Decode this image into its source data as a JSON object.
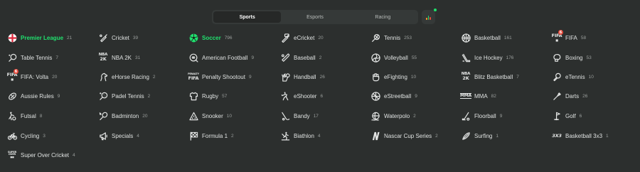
{
  "nav": {
    "tabs": [
      {
        "label": "Sports",
        "active": true
      },
      {
        "label": "Esports",
        "active": false
      },
      {
        "label": "Racing",
        "active": false
      }
    ],
    "stats_icon": "bar-chart-icon",
    "live_indicator_color": "#1fdf6b"
  },
  "colors": {
    "selected": "#20e06e",
    "background": "#2c2f2e",
    "badge": "#e94b3c"
  },
  "sports": [
    {
      "id": "premier-league",
      "label": "Premier League",
      "count": "21",
      "icon": "england-flag-icon",
      "selected": true
    },
    {
      "id": "cricket",
      "label": "Cricket",
      "count": "39",
      "icon": "cricket-bat-icon"
    },
    {
      "id": "soccer",
      "label": "Soccer",
      "count": "796",
      "icon": "soccer-ball-icon",
      "selected": true
    },
    {
      "id": "ecricket",
      "label": "eCricket",
      "count": "20",
      "icon": "ecricket-icon"
    },
    {
      "id": "tennis",
      "label": "Tennis",
      "count": "253",
      "icon": "tennis-racket-icon"
    },
    {
      "id": "basketball",
      "label": "Basketball",
      "count": "161",
      "icon": "basketball-icon"
    },
    {
      "id": "fifa",
      "label": "FIFA",
      "count": "58",
      "icon": "fifa-logo-icon",
      "badge": "6"
    },
    {
      "id": "table-tennis",
      "label": "Table Tennis",
      "count": "7",
      "icon": "table-tennis-icon"
    },
    {
      "id": "nba2k",
      "label": "NBA 2K",
      "count": "31",
      "icon": "nba2k-logo-icon"
    },
    {
      "id": "american-football",
      "label": "American Football",
      "count": "9",
      "icon": "american-football-icon"
    },
    {
      "id": "baseball",
      "label": "Baseball",
      "count": "2",
      "icon": "baseball-bat-icon"
    },
    {
      "id": "volleyball",
      "label": "Volleyball",
      "count": "55",
      "icon": "volleyball-icon"
    },
    {
      "id": "ice-hockey",
      "label": "Ice Hockey",
      "count": "176",
      "icon": "hockey-stick-icon"
    },
    {
      "id": "boxing",
      "label": "Boxing",
      "count": "53",
      "icon": "boxing-glove-icon"
    },
    {
      "id": "fifa-volta",
      "label": "FIFA: Volta",
      "count": "20",
      "icon": "fifa-logo-icon",
      "badge": "6"
    },
    {
      "id": "ehorse-racing",
      "label": "eHorse Racing",
      "count": "2",
      "icon": "horse-icon"
    },
    {
      "id": "penalty-shootout",
      "label": "Penalty Shootout",
      "count": "9",
      "icon": "penalty-fifa-logo-icon"
    },
    {
      "id": "handball",
      "label": "Handball",
      "count": "26",
      "icon": "handball-icon"
    },
    {
      "id": "efighting",
      "label": "eFighting",
      "count": "10",
      "icon": "fist-icon"
    },
    {
      "id": "blitz-basketball",
      "label": "Blitz Basketball",
      "count": "7",
      "icon": "nba2k-logo-icon"
    },
    {
      "id": "etennis",
      "label": "eTennis",
      "count": "10",
      "icon": "etennis-icon"
    },
    {
      "id": "aussie-rules",
      "label": "Aussie Rules",
      "count": "9",
      "icon": "aussie-rules-ball-icon"
    },
    {
      "id": "padel-tennis",
      "label": "Padel Tennis",
      "count": "2",
      "icon": "padel-racket-icon"
    },
    {
      "id": "rugby",
      "label": "Rugby",
      "count": "57",
      "icon": "rugby-shirt-icon"
    },
    {
      "id": "eshooter",
      "label": "eShooter",
      "count": "6",
      "icon": "shooter-icon"
    },
    {
      "id": "estreetball",
      "label": "eStreetball",
      "count": "9",
      "icon": "streetball-icon"
    },
    {
      "id": "mma",
      "label": "MMA",
      "count": "82",
      "icon": "mma-logo-icon"
    },
    {
      "id": "darts",
      "label": "Darts",
      "count": "26",
      "icon": "dart-icon"
    },
    {
      "id": "futsal",
      "label": "Futsal",
      "count": "8",
      "icon": "futsal-icon"
    },
    {
      "id": "badminton",
      "label": "Badminton",
      "count": "20",
      "icon": "badminton-racket-icon"
    },
    {
      "id": "snooker",
      "label": "Snooker",
      "count": "10",
      "icon": "snooker-triangle-icon"
    },
    {
      "id": "bandy",
      "label": "Bandy",
      "count": "17",
      "icon": "bandy-stick-icon"
    },
    {
      "id": "waterpolo",
      "label": "Waterpolo",
      "count": "2",
      "icon": "waterpolo-ball-icon"
    },
    {
      "id": "floorball",
      "label": "Floorball",
      "count": "9",
      "icon": "floorball-stick-icon"
    },
    {
      "id": "golf",
      "label": "Golf",
      "count": "6",
      "icon": "golf-flag-icon"
    },
    {
      "id": "cycling",
      "label": "Cycling",
      "count": "3",
      "icon": "bicycle-icon"
    },
    {
      "id": "specials",
      "label": "Specials",
      "count": "4",
      "icon": "megaphone-icon"
    },
    {
      "id": "formula1",
      "label": "Formula 1",
      "count": "2",
      "icon": "checkered-flag-icon"
    },
    {
      "id": "biathlon",
      "label": "Biathlon",
      "count": "4",
      "icon": "biathlon-skier-icon"
    },
    {
      "id": "nascar",
      "label": "Nascar Cup Series",
      "count": "2",
      "icon": "nascar-logo-icon"
    },
    {
      "id": "surfing",
      "label": "Surfing",
      "count": "1",
      "icon": "surfboard-icon"
    },
    {
      "id": "basketball-3x3",
      "label": "Basketball 3x3",
      "count": "1",
      "icon": "fiba-3x3-logo-icon"
    },
    {
      "id": "super-over-cricket",
      "label": "Super Over Cricket",
      "count": "4",
      "icon": "super-over-logo-icon"
    }
  ]
}
